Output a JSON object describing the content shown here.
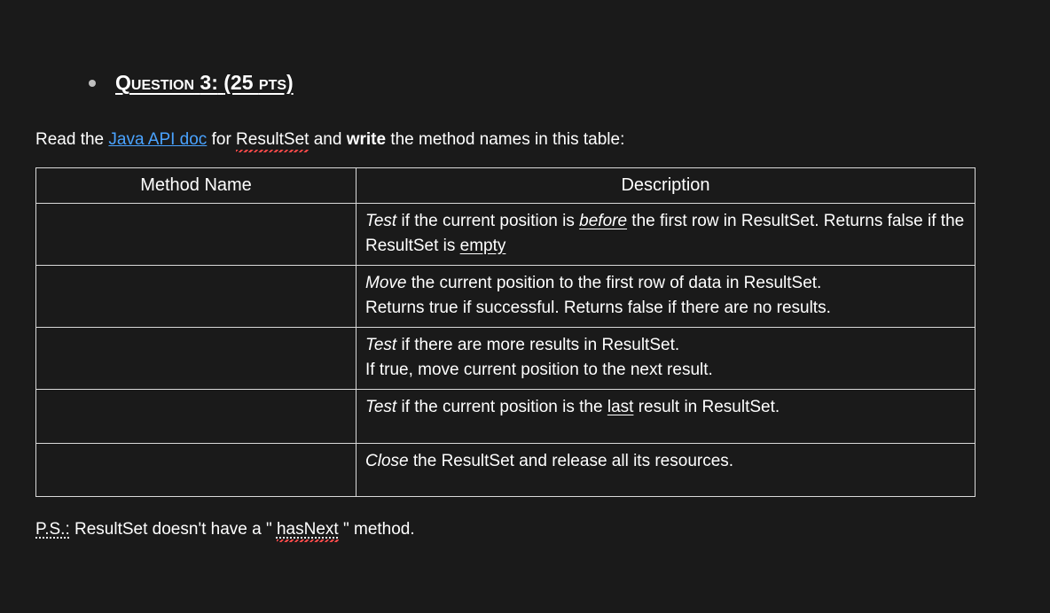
{
  "heading": {
    "prefix": "Question",
    "number": "3:",
    "points_open": "(25",
    "points_word": "pts)",
    "full_aria": "Question 3: (25 pts)"
  },
  "instruction": {
    "t1": "Read the ",
    "link": "Java API doc",
    "t2": " for ",
    "err1": "ResultSet",
    "t3": " and ",
    "bold": "write",
    "t4": " the method names in this table:"
  },
  "table": {
    "h1": "Method Name",
    "h2": "Description",
    "rows": [
      {
        "segments": [
          {
            "text": "Test",
            "cls": "italic"
          },
          {
            "text": " if the current position is "
          },
          {
            "text": "before",
            "cls": "italic underline"
          },
          {
            "text": " the first row in "
          },
          {
            "text": "ResultSet",
            "cls": ""
          },
          {
            "text": ". Returns "
          },
          {
            "text": "false",
            "cls": ""
          },
          {
            "text": " if the "
          },
          {
            "text": "ResultSet",
            "cls": ""
          },
          {
            "text": " is "
          },
          {
            "text": "empty",
            "cls": "underline"
          }
        ]
      },
      {
        "segments": [
          {
            "text": "Move",
            "cls": "italic"
          },
          {
            "text": " the current position to the first row of data in "
          },
          {
            "text": "ResultSet",
            "cls": ""
          },
          {
            "text": "."
          },
          {
            "text": "\n"
          },
          {
            "text": "Returns "
          },
          {
            "text": "true",
            "cls": ""
          },
          {
            "text": " if successful. Returns "
          },
          {
            "text": "false",
            "cls": ""
          },
          {
            "text": " if there are no results."
          }
        ]
      },
      {
        "segments": [
          {
            "text": "Test",
            "cls": "italic"
          },
          {
            "text": " if there are more results in "
          },
          {
            "text": "ResultSet",
            "cls": ""
          },
          {
            "text": "."
          },
          {
            "text": "\n"
          },
          {
            "text": "If true, move current position to the next result."
          }
        ]
      },
      {
        "segments": [
          {
            "text": "Test",
            "cls": "italic"
          },
          {
            "text": " if the current position is the "
          },
          {
            "text": "last",
            "cls": "underline"
          },
          {
            "text": " result in "
          },
          {
            "text": "ResultSet",
            "cls": ""
          },
          {
            "text": "."
          }
        ],
        "extra_height": true
      },
      {
        "segments": [
          {
            "text": "Close",
            "cls": "italic"
          },
          {
            "text": " the "
          },
          {
            "text": "ResultSet",
            "cls": ""
          },
          {
            "text": " and release all its resources."
          }
        ],
        "extra_height": true
      }
    ]
  },
  "ps": {
    "label": "P.S.:",
    "t1": " ResultSet",
    "t2": " doesn't have a \"",
    "err": "hasNext",
    "t3": "\" method."
  }
}
